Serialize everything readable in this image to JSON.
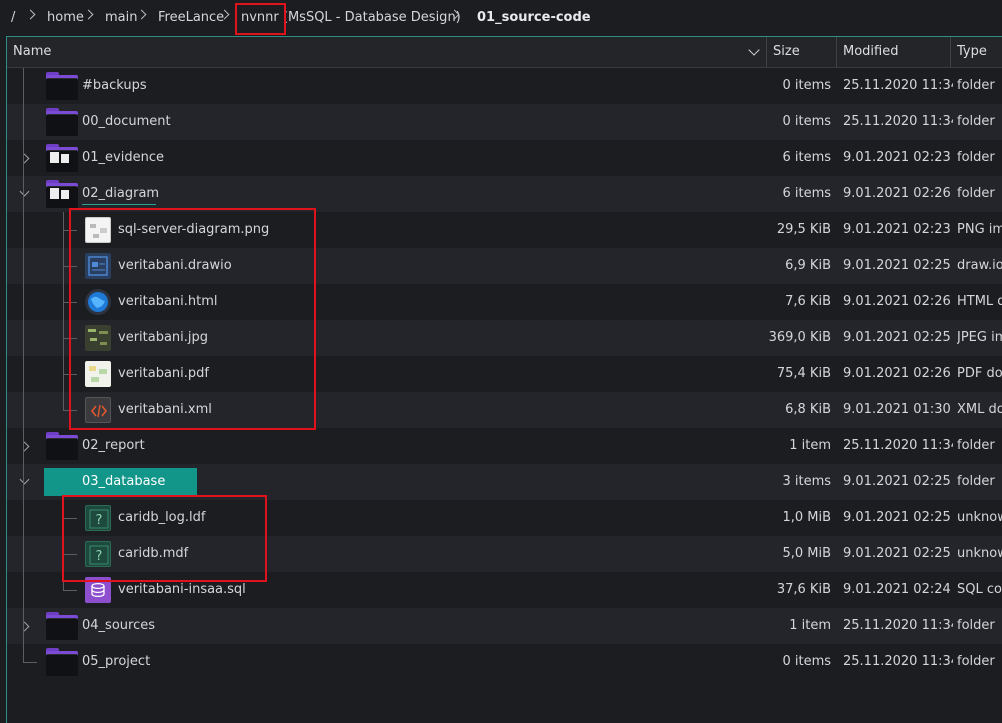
{
  "breadcrumb": [
    "/",
    "home",
    "main",
    "FreeLance",
    "nvnnr (MsSQL - Database Design)",
    "01_source-code"
  ],
  "columns": {
    "name": "Name",
    "size": "Size",
    "modified": "Modified",
    "type": "Type"
  },
  "rows": [
    {
      "name": "#backups",
      "size": "0 items",
      "modified": "25.11.2020 11:34",
      "type": "folder",
      "icon": "folder-icon"
    },
    {
      "name": "00_document",
      "size": "0 items",
      "modified": "25.11.2020 11:34",
      "type": "folder",
      "icon": "folder-icon"
    },
    {
      "name": "01_evidence",
      "size": "6 items",
      "modified": "9.01.2021 02:23",
      "type": "folder",
      "icon": "folder-icon",
      "expander": "collapsed"
    },
    {
      "name": "02_diagram",
      "size": "6 items",
      "modified": "9.01.2021 02:26",
      "type": "folder",
      "icon": "folder-icon",
      "expander": "expanded"
    },
    {
      "name": "sql-server-diagram.png",
      "size": "29,5 KiB",
      "modified": "9.01.2021 02:23",
      "type": "PNG image",
      "icon": "image-thumbnail-icon"
    },
    {
      "name": "veritabani.drawio",
      "size": "6,9 KiB",
      "modified": "9.01.2021 02:25",
      "type": "draw.io diagram",
      "icon": "drawio-file-icon"
    },
    {
      "name": "veritabani.html",
      "size": "7,6 KiB",
      "modified": "9.01.2021 02:26",
      "type": "HTML document",
      "icon": "html-globe-icon"
    },
    {
      "name": "veritabani.jpg",
      "size": "369,0 KiB",
      "modified": "9.01.2021 02:25",
      "type": "JPEG image",
      "icon": "jpeg-thumbnail-icon"
    },
    {
      "name": "veritabani.pdf",
      "size": "75,4 KiB",
      "modified": "9.01.2021 02:26",
      "type": "PDF document",
      "icon": "pdf-thumbnail-icon"
    },
    {
      "name": "veritabani.xml",
      "size": "6,8 KiB",
      "modified": "9.01.2021 01:30",
      "type": "XML document",
      "icon": "xml-code-icon"
    },
    {
      "name": "02_report",
      "size": "1 item",
      "modified": "25.11.2020 11:34",
      "type": "folder",
      "icon": "folder-icon",
      "expander": "collapsed"
    },
    {
      "name": "03_database",
      "size": "3 items",
      "modified": "9.01.2021 02:25",
      "type": "folder",
      "icon": "folder-icon",
      "expander": "expanded",
      "selected": true
    },
    {
      "name": "caridb_log.ldf",
      "size": "1,0 MiB",
      "modified": "9.01.2021 02:25",
      "type": "unknown",
      "icon": "unknown-file-icon"
    },
    {
      "name": "caridb.mdf",
      "size": "5,0 MiB",
      "modified": "9.01.2021 02:25",
      "type": "unknown",
      "icon": "unknown-file-icon"
    },
    {
      "name": "veritabani-insaa.sql",
      "size": "37,6 KiB",
      "modified": "9.01.2021 02:24",
      "type": "SQL code",
      "icon": "database-file-icon"
    },
    {
      "name": "04_sources",
      "size": "1 item",
      "modified": "25.11.2020 11:34",
      "type": "folder",
      "icon": "folder-icon",
      "expander": "collapsed"
    },
    {
      "name": "05_project",
      "size": "0 items",
      "modified": "25.11.2020 11:34",
      "type": "folder",
      "icon": "folder-icon"
    }
  ],
  "colors": {
    "accent": "#12968a",
    "folder": "#7b4bd6",
    "annotation": "#e0131d"
  }
}
